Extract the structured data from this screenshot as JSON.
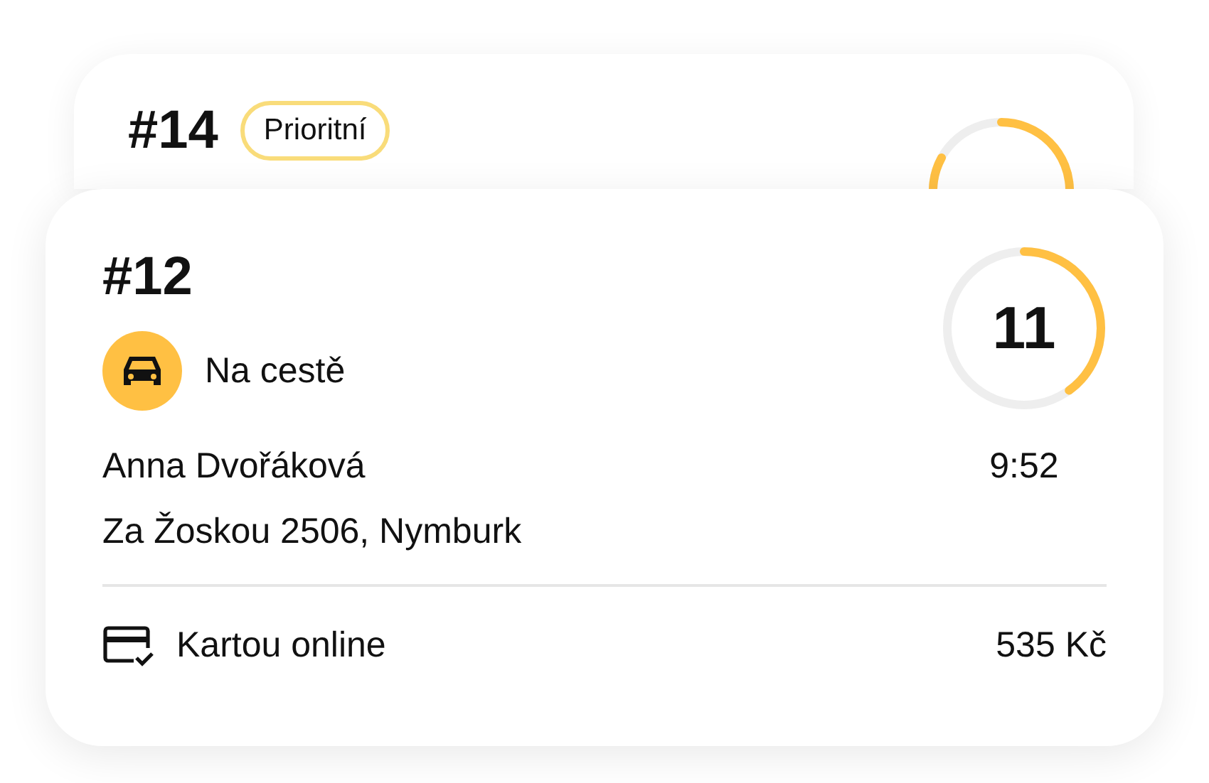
{
  "back_order": {
    "number": "#14",
    "badge": "Prioritní"
  },
  "order": {
    "number": "#12",
    "status": {
      "kind": "driving",
      "label": "Na cestě"
    },
    "countdown": {
      "value": "11",
      "level": 0.4
    },
    "customer": "Anna Dvořáková",
    "time": "9:52",
    "address": "Za Žoskou 2506, Nymburk",
    "payment": {
      "kind": "card",
      "label": "Kartou online"
    },
    "price": "535 Kč"
  }
}
